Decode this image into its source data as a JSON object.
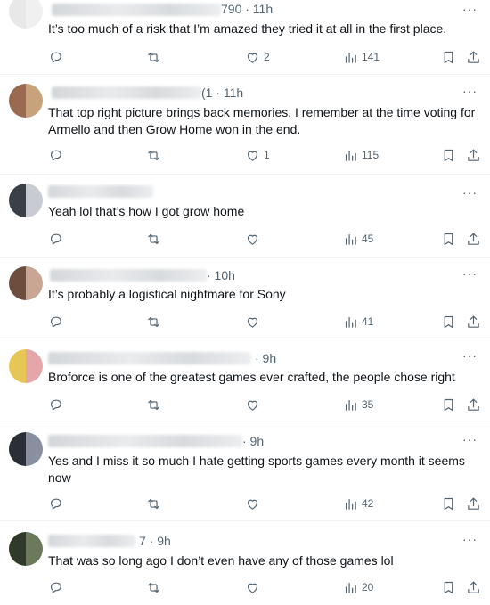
{
  "more_glyph": "···",
  "tweets": [
    {
      "meta": "790 · 11h",
      "text": "It’s too much of a risk that I’m amazed they tried it at all in the first place.",
      "likes": "2",
      "views": "141",
      "avatar_colors": [
        "#e8e8e8",
        "#f0f0f0"
      ]
    },
    {
      "meta": "(1 · 11h",
      "text": "That top right picture brings back memories. I remember at the time voting for Armello and then Grow Home won in the end.",
      "likes": "1",
      "views": "115",
      "avatar_colors": [
        "#9a6a50",
        "#c8a27a"
      ]
    },
    {
      "meta": "",
      "text": "Yeah lol that’s how I got grow home",
      "likes": "",
      "views": "45",
      "avatar_colors": [
        "#3a4048",
        "#c8ccd2"
      ]
    },
    {
      "meta": "· 10h",
      "text": "It’s probably a logistical nightmare for Sony",
      "likes": "",
      "views": "41",
      "avatar_colors": [
        "#6b4e3e",
        "#c9a693"
      ]
    },
    {
      "meta": "· 9h",
      "text": "Broforce is one of the greatest games ever crafted, the people chose right",
      "likes": "",
      "views": "35",
      "avatar_colors": [
        "#e6c655",
        "#e4a6a8"
      ]
    },
    {
      "meta": "· 9h",
      "text": "Yes and I miss it so much I hate getting sports games every month it seems now",
      "likes": "",
      "views": "42",
      "avatar_colors": [
        "#2b2e36",
        "#8890a0"
      ]
    },
    {
      "meta": "7 · 9h",
      "text": "That was so long ago I don’t even have any of those games lol",
      "likes": "",
      "views": "20",
      "avatar_colors": [
        "#2f3a2a",
        "#6b7a5a"
      ]
    }
  ]
}
